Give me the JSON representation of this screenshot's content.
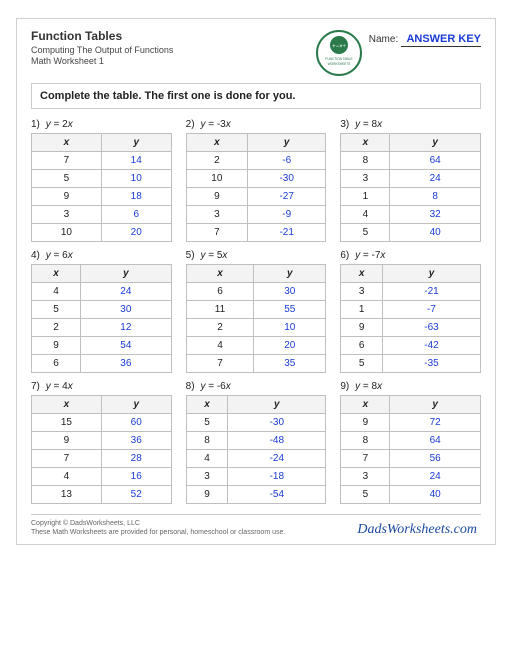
{
  "header": {
    "title": "Function Tables",
    "subtitle": "Computing The Output of Functions",
    "ws_num": "Math Worksheet 1",
    "name_label": "Name:",
    "answer_key": "ANSWER KEY",
    "badge_text": "FUNCTION TABLE WORKSHEETS"
  },
  "instruction": "Complete the table. The first one is done for you.",
  "col_x": "x",
  "col_y": "y",
  "problems": [
    {
      "n": "1)",
      "eq": "y = 2x",
      "rows": [
        [
          "7",
          "14"
        ],
        [
          "5",
          "10"
        ],
        [
          "9",
          "18"
        ],
        [
          "3",
          "6"
        ],
        [
          "10",
          "20"
        ]
      ]
    },
    {
      "n": "2)",
      "eq": "y = -3x",
      "rows": [
        [
          "2",
          "-6"
        ],
        [
          "10",
          "-30"
        ],
        [
          "9",
          "-27"
        ],
        [
          "3",
          "-9"
        ],
        [
          "7",
          "-21"
        ]
      ]
    },
    {
      "n": "3)",
      "eq": "y = 8x",
      "rows": [
        [
          "8",
          "64"
        ],
        [
          "3",
          "24"
        ],
        [
          "1",
          "8"
        ],
        [
          "4",
          "32"
        ],
        [
          "5",
          "40"
        ]
      ]
    },
    {
      "n": "4)",
      "eq": "y = 6x",
      "rows": [
        [
          "4",
          "24"
        ],
        [
          "5",
          "30"
        ],
        [
          "2",
          "12"
        ],
        [
          "9",
          "54"
        ],
        [
          "6",
          "36"
        ]
      ]
    },
    {
      "n": "5)",
      "eq": "y = 5x",
      "rows": [
        [
          "6",
          "30"
        ],
        [
          "11",
          "55"
        ],
        [
          "2",
          "10"
        ],
        [
          "4",
          "20"
        ],
        [
          "7",
          "35"
        ]
      ]
    },
    {
      "n": "6)",
      "eq": "y = -7x",
      "rows": [
        [
          "3",
          "-21"
        ],
        [
          "1",
          "-7"
        ],
        [
          "9",
          "-63"
        ],
        [
          "6",
          "-42"
        ],
        [
          "5",
          "-35"
        ]
      ]
    },
    {
      "n": "7)",
      "eq": "y = 4x",
      "rows": [
        [
          "15",
          "60"
        ],
        [
          "9",
          "36"
        ],
        [
          "7",
          "28"
        ],
        [
          "4",
          "16"
        ],
        [
          "13",
          "52"
        ]
      ]
    },
    {
      "n": "8)",
      "eq": "y = -6x",
      "rows": [
        [
          "5",
          "-30"
        ],
        [
          "8",
          "-48"
        ],
        [
          "4",
          "-24"
        ],
        [
          "3",
          "-18"
        ],
        [
          "9",
          "-54"
        ]
      ]
    },
    {
      "n": "9)",
      "eq": "y = 8x",
      "rows": [
        [
          "9",
          "72"
        ],
        [
          "8",
          "64"
        ],
        [
          "7",
          "56"
        ],
        [
          "3",
          "24"
        ],
        [
          "5",
          "40"
        ]
      ]
    }
  ],
  "footer": {
    "copyright": "Copyright © DadsWorksheets, LLC",
    "note": "These Math Worksheets are provided for personal, homeschool or classroom use.",
    "watermark": "DadsWorksheets.com"
  }
}
